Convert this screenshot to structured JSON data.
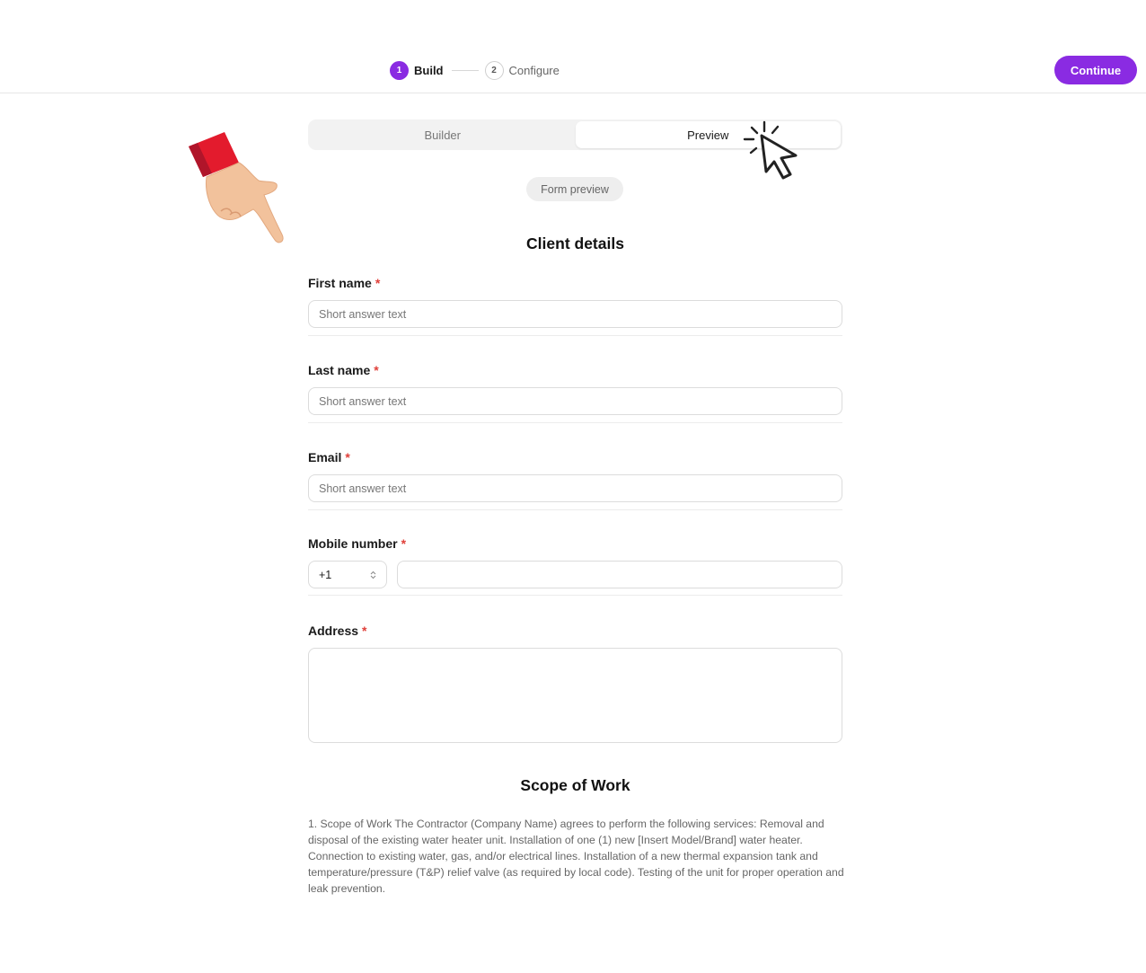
{
  "header": {
    "steps": [
      {
        "number": "1",
        "label": "Build",
        "active": true
      },
      {
        "number": "2",
        "label": "Configure",
        "active": false
      }
    ],
    "continue_label": "Continue",
    "accent_color": "#8a2be2"
  },
  "tabs": [
    {
      "label": "Builder",
      "active": false
    },
    {
      "label": "Preview",
      "active": true
    }
  ],
  "preview_badge": "Form preview",
  "client_section": {
    "title": "Client details",
    "fields": [
      {
        "label": "First name",
        "required_mark": "*",
        "placeholder": "Short answer text"
      },
      {
        "label": "Last name",
        "required_mark": "*",
        "placeholder": "Short answer text"
      },
      {
        "label": "Email",
        "required_mark": "*",
        "placeholder": "Short answer text"
      },
      {
        "label": "Mobile number",
        "required_mark": "*",
        "country_code": "+1"
      },
      {
        "label": "Address",
        "required_mark": "*"
      }
    ]
  },
  "scope_section": {
    "title": "Scope of Work",
    "body": "1. Scope of Work The Contractor (Company Name) agrees to perform the following services: Removal and disposal of the existing water heater unit. Installation of one (1) new [Insert Model/Brand] water heater. Connection to existing water, gas, and/or electrical lines. Installation of a new thermal expansion tank and temperature/pressure (T&P) relief valve (as required by local code). Testing of the unit for proper operation and leak prevention."
  },
  "overlays": {
    "hand_icon": "pointing-hand-icon",
    "cursor_icon": "click-cursor-icon"
  }
}
